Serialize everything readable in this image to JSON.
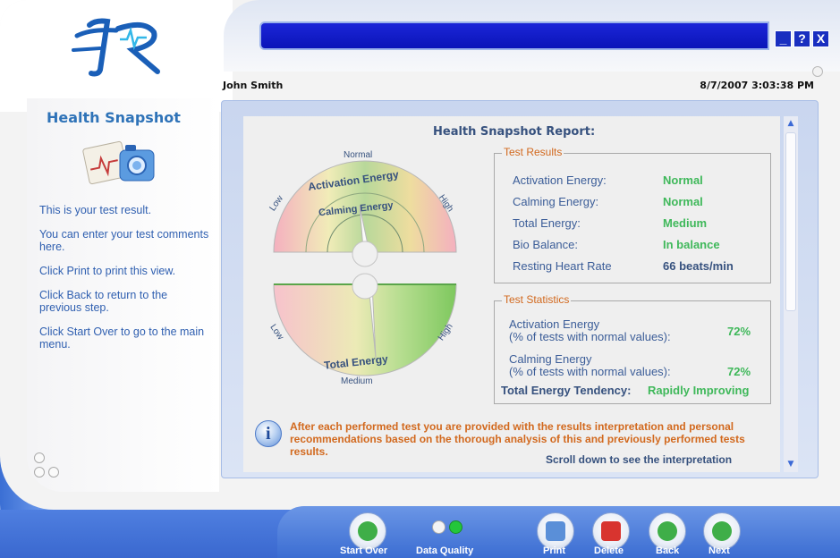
{
  "window": {
    "buttons": [
      "_",
      "?",
      "X"
    ]
  },
  "header": {
    "user_name": "John Smith",
    "datetime": "8/7/2007 3:03:38 PM"
  },
  "sidebar": {
    "title": "Health Snapshot",
    "icon": "health-snapshot-icon",
    "help": [
      "This is your test result.",
      "You can enter your test comments here.",
      "Click Print to print this view.",
      "Click Back to return to the previous step.",
      "Click Start Over to go to the main menu."
    ]
  },
  "report": {
    "title": "Health Snapshot Report:",
    "gauges": {
      "top": {
        "outer_label": "Activation Energy",
        "inner_label": "Calming Energy",
        "low": "Low",
        "normal": "Normal",
        "high": "High"
      },
      "bottom": {
        "label": "Total Energy",
        "low": "Low",
        "medium": "Medium",
        "high": "High"
      }
    },
    "test_results": {
      "title": "Test Results",
      "rows": [
        {
          "label": "Activation Energy:",
          "value": "Normal"
        },
        {
          "label": "Calming Energy:",
          "value": "Normal"
        },
        {
          "label": "Total Energy:",
          "value": "Medium"
        },
        {
          "label": "Bio Balance:",
          "value": "In balance"
        },
        {
          "label": "Resting Heart Rate",
          "value": "66 beats/min"
        }
      ]
    },
    "test_statistics": {
      "title": "Test Statistics",
      "activation_label": "Activation Energy",
      "activation_sub": "(% of tests with normal values):",
      "activation_value": "72%",
      "calming_label": "Calming Energy",
      "calming_sub": "(% of tests with normal values):",
      "calming_value": "72%",
      "tendency_label": "Total Energy Tendency:",
      "tendency_value": "Rapidly Improving"
    },
    "info_text": "After each performed test  you are provided with the results interpretation and personal recommendations based on the thorough analysis of this and previously performed tests results.",
    "scroll_hint": "Scroll down to see the interpretation"
  },
  "toolbar": {
    "start_over": "Start Over",
    "data_quality": "Data Quality",
    "print": "Print",
    "delete": "Delete",
    "back": "Back",
    "next": "Next"
  },
  "colors": {
    "title_bar": "#0a14b8",
    "accent_blue": "#2f73b8",
    "result_green": "#3fb85a",
    "orange_text": "#d2691e"
  }
}
